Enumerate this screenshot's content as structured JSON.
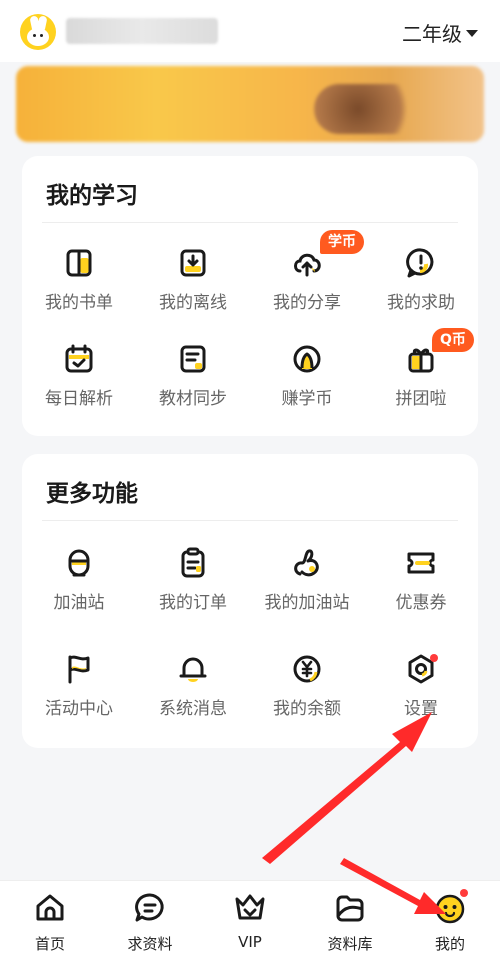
{
  "header": {
    "grade_label": "二年级"
  },
  "my_learning": {
    "title": "我的学习",
    "items": [
      {
        "label": "我的书单",
        "icon": "book-icon"
      },
      {
        "label": "我的离线",
        "icon": "download-icon"
      },
      {
        "label": "我的分享",
        "icon": "upload-cloud-icon",
        "badge": "学币"
      },
      {
        "label": "我的求助",
        "icon": "help-icon"
      },
      {
        "label": "每日解析",
        "icon": "calendar-check-icon"
      },
      {
        "label": "教材同步",
        "icon": "textbook-icon"
      },
      {
        "label": "赚学币",
        "icon": "coin-icon"
      },
      {
        "label": "拼团啦",
        "icon": "gift-icon",
        "badge": "Q币"
      }
    ]
  },
  "more_functions": {
    "title": "更多功能",
    "items": [
      {
        "label": "加油站",
        "icon": "station-icon"
      },
      {
        "label": "我的订单",
        "icon": "clipboard-icon"
      },
      {
        "label": "我的加油站",
        "icon": "swirl-icon"
      },
      {
        "label": "优惠券",
        "icon": "ticket-icon"
      },
      {
        "label": "活动中心",
        "icon": "flag-icon"
      },
      {
        "label": "系统消息",
        "icon": "bell-icon"
      },
      {
        "label": "我的余额",
        "icon": "yen-icon"
      },
      {
        "label": "设置",
        "icon": "gear-icon"
      }
    ]
  },
  "tabbar": {
    "items": [
      {
        "label": "首页",
        "icon": "home-icon"
      },
      {
        "label": "求资料",
        "icon": "chat-icon"
      },
      {
        "label": "VIP",
        "icon": "crown-icon"
      },
      {
        "label": "资料库",
        "icon": "folder-icon"
      },
      {
        "label": "我的",
        "icon": "smiley-icon"
      }
    ]
  },
  "colors": {
    "accent": "#ffd21f",
    "badge": "#ff5a1f",
    "annotation_arrow": "#ff2a2a"
  }
}
